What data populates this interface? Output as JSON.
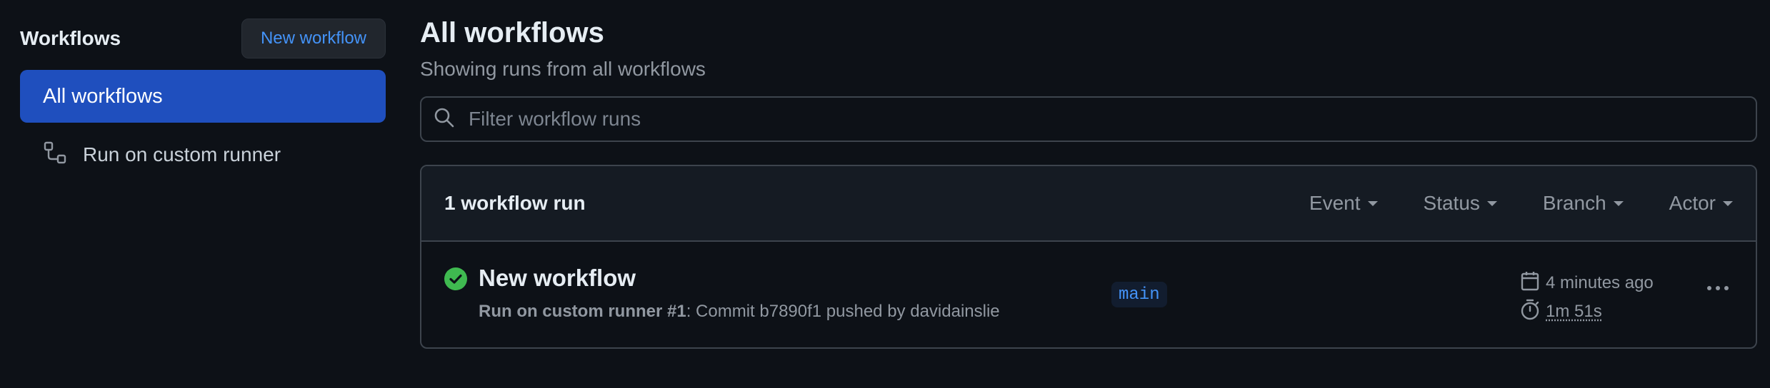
{
  "sidebar": {
    "title": "Workflows",
    "new_button": "New workflow",
    "items": [
      {
        "label": "All workflows",
        "active": true
      },
      {
        "label": "Run on custom runner",
        "icon": "workflow-icon",
        "active": false
      }
    ]
  },
  "main": {
    "title": "All workflows",
    "subtitle": "Showing runs from all workflows",
    "search": {
      "placeholder": "Filter workflow runs",
      "value": ""
    },
    "runs_header": {
      "count_label": "1 workflow run",
      "filters": [
        "Event",
        "Status",
        "Branch",
        "Actor"
      ]
    },
    "runs": [
      {
        "status": "success",
        "title": "New workflow",
        "workflow": "Run on custom runner #1",
        "description": ": Commit b7890f1 pushed by davidainslie",
        "branch": "main",
        "time_ago": "4 minutes ago",
        "duration": "1m 51s"
      }
    ]
  },
  "colors": {
    "background": "#0d1117",
    "accent": "#1f4fbe",
    "link": "#4493f8",
    "success": "#3fb950",
    "muted": "#9198a1"
  }
}
